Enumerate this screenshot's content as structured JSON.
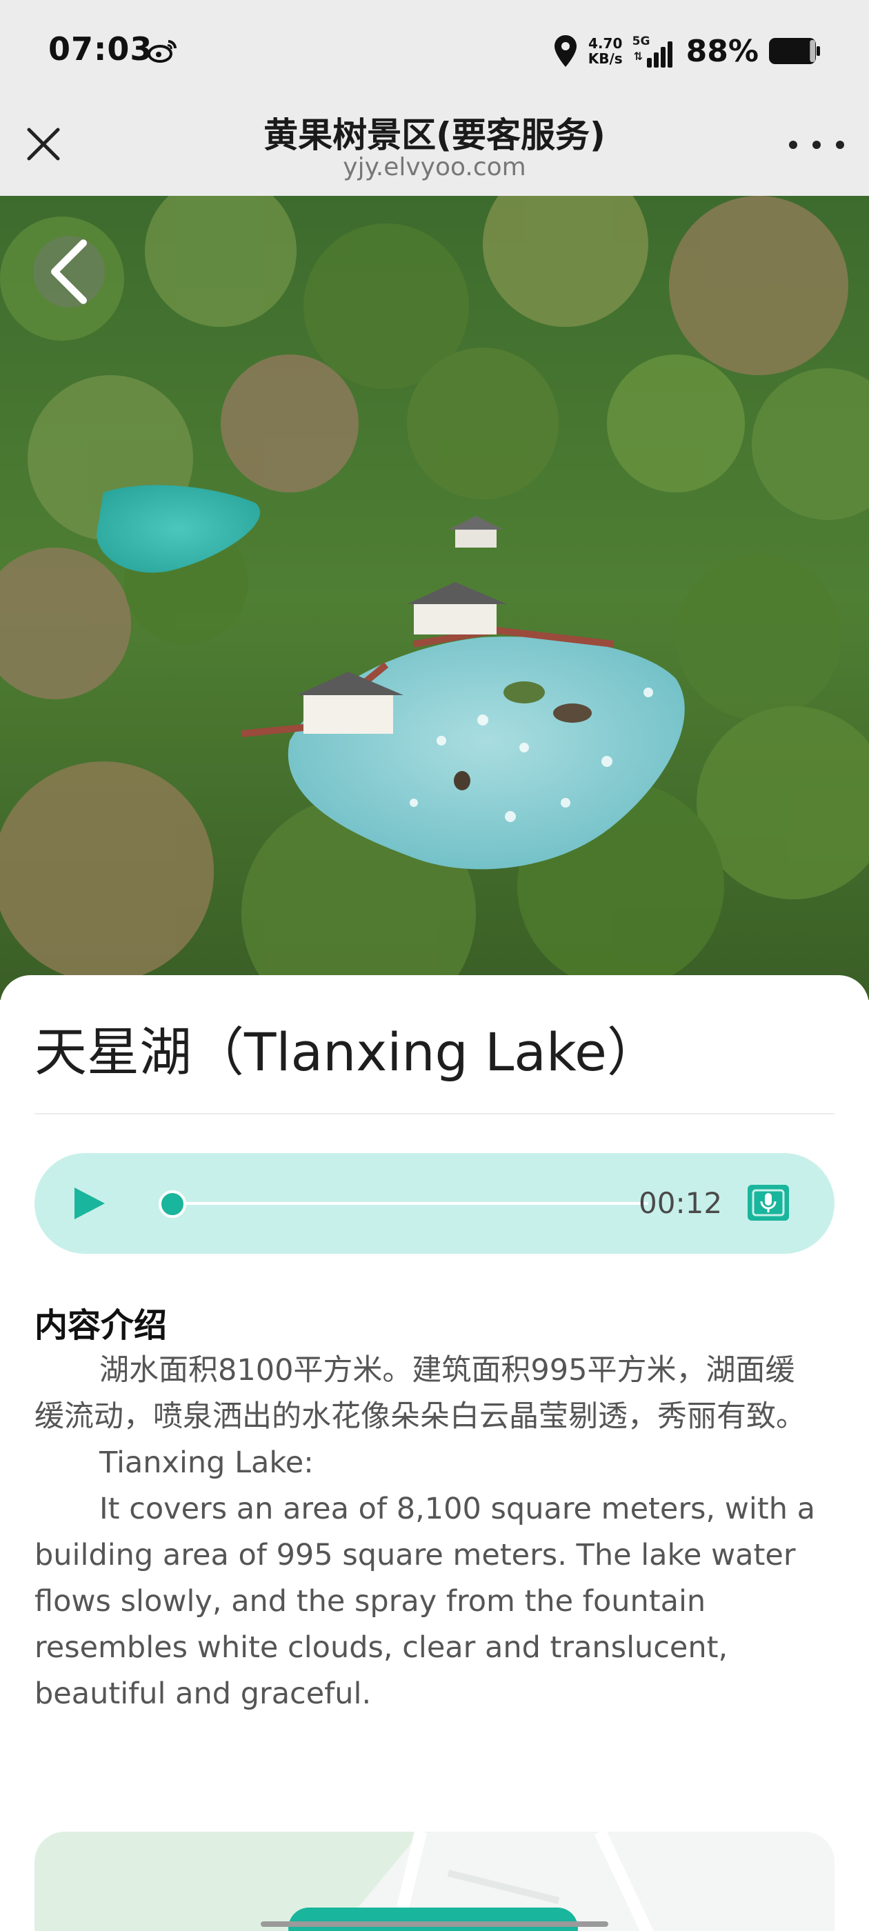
{
  "status_bar": {
    "time": "07:03",
    "speed_value": "4.70",
    "speed_unit": "KB/s",
    "network": "5G",
    "battery": "88%",
    "battery_level": 0.88,
    "icons": [
      "weibo-icon",
      "location-icon",
      "signal-icon",
      "battery-icon"
    ]
  },
  "title_bar": {
    "title": "黄果树景区(要客服务)",
    "url": "yjy.elvyoo.com",
    "icons": [
      "close-icon",
      "more-icon"
    ]
  },
  "spot": {
    "title": "天星湖（Tlanxing Lake）"
  },
  "audio": {
    "time": "00:12",
    "progress": 0.0,
    "icons": [
      "play-icon",
      "audio-guide-icon"
    ]
  },
  "content": {
    "heading": "内容介绍",
    "para_cn": "湖水面积8100平方米。建筑面积995平方米，湖面缓缓流动，喷泉洒出的水花像朵朵白云晶莹剔透，秀丽有致。",
    "para_en_title": "Tianxing Lake:",
    "para_en": "It covers an area of 8,100 square meters, with a building area of 995 square meters. The lake water flows slowly, and the spray from the fountain resembles white clouds, clear and translucent, beautiful and graceful."
  },
  "colors": {
    "accent": "#19b59c",
    "audio_bg": "#c8f0ea",
    "header_bg": "#ececec"
  }
}
